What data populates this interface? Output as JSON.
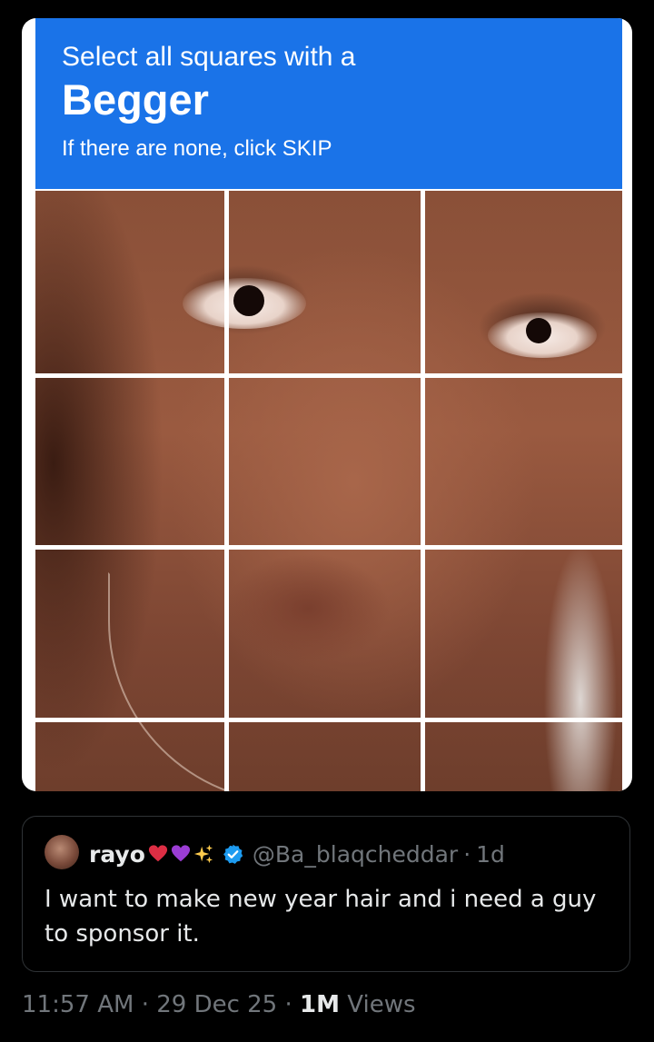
{
  "captcha": {
    "prompt": "Select all squares with a",
    "target": "Begger",
    "skip_hint": "If there are none, click SKIP",
    "grid_rows": 3,
    "grid_cols": 3,
    "header_color": "#1a73e8"
  },
  "quote": {
    "author_name": "rayo",
    "author_emojis": [
      "red-heart-icon",
      "purple-heart-icon",
      "sparkles-icon"
    ],
    "verified": true,
    "handle": "@Ba_blaqcheddar",
    "separator": "·",
    "time": "1d",
    "text": "I want to make new year hair and i need a guy to sponsor it."
  },
  "meta": {
    "time": "11:57 AM",
    "sep1": "·",
    "date": "29 Dec 25",
    "sep2": "·",
    "views_count": "1M",
    "views_label": "Views"
  },
  "colors": {
    "background": "#000000",
    "text_primary": "#e7e9ea",
    "text_secondary": "#71767b",
    "verified_blue": "#1d9bf0",
    "border": "#2f3336"
  }
}
